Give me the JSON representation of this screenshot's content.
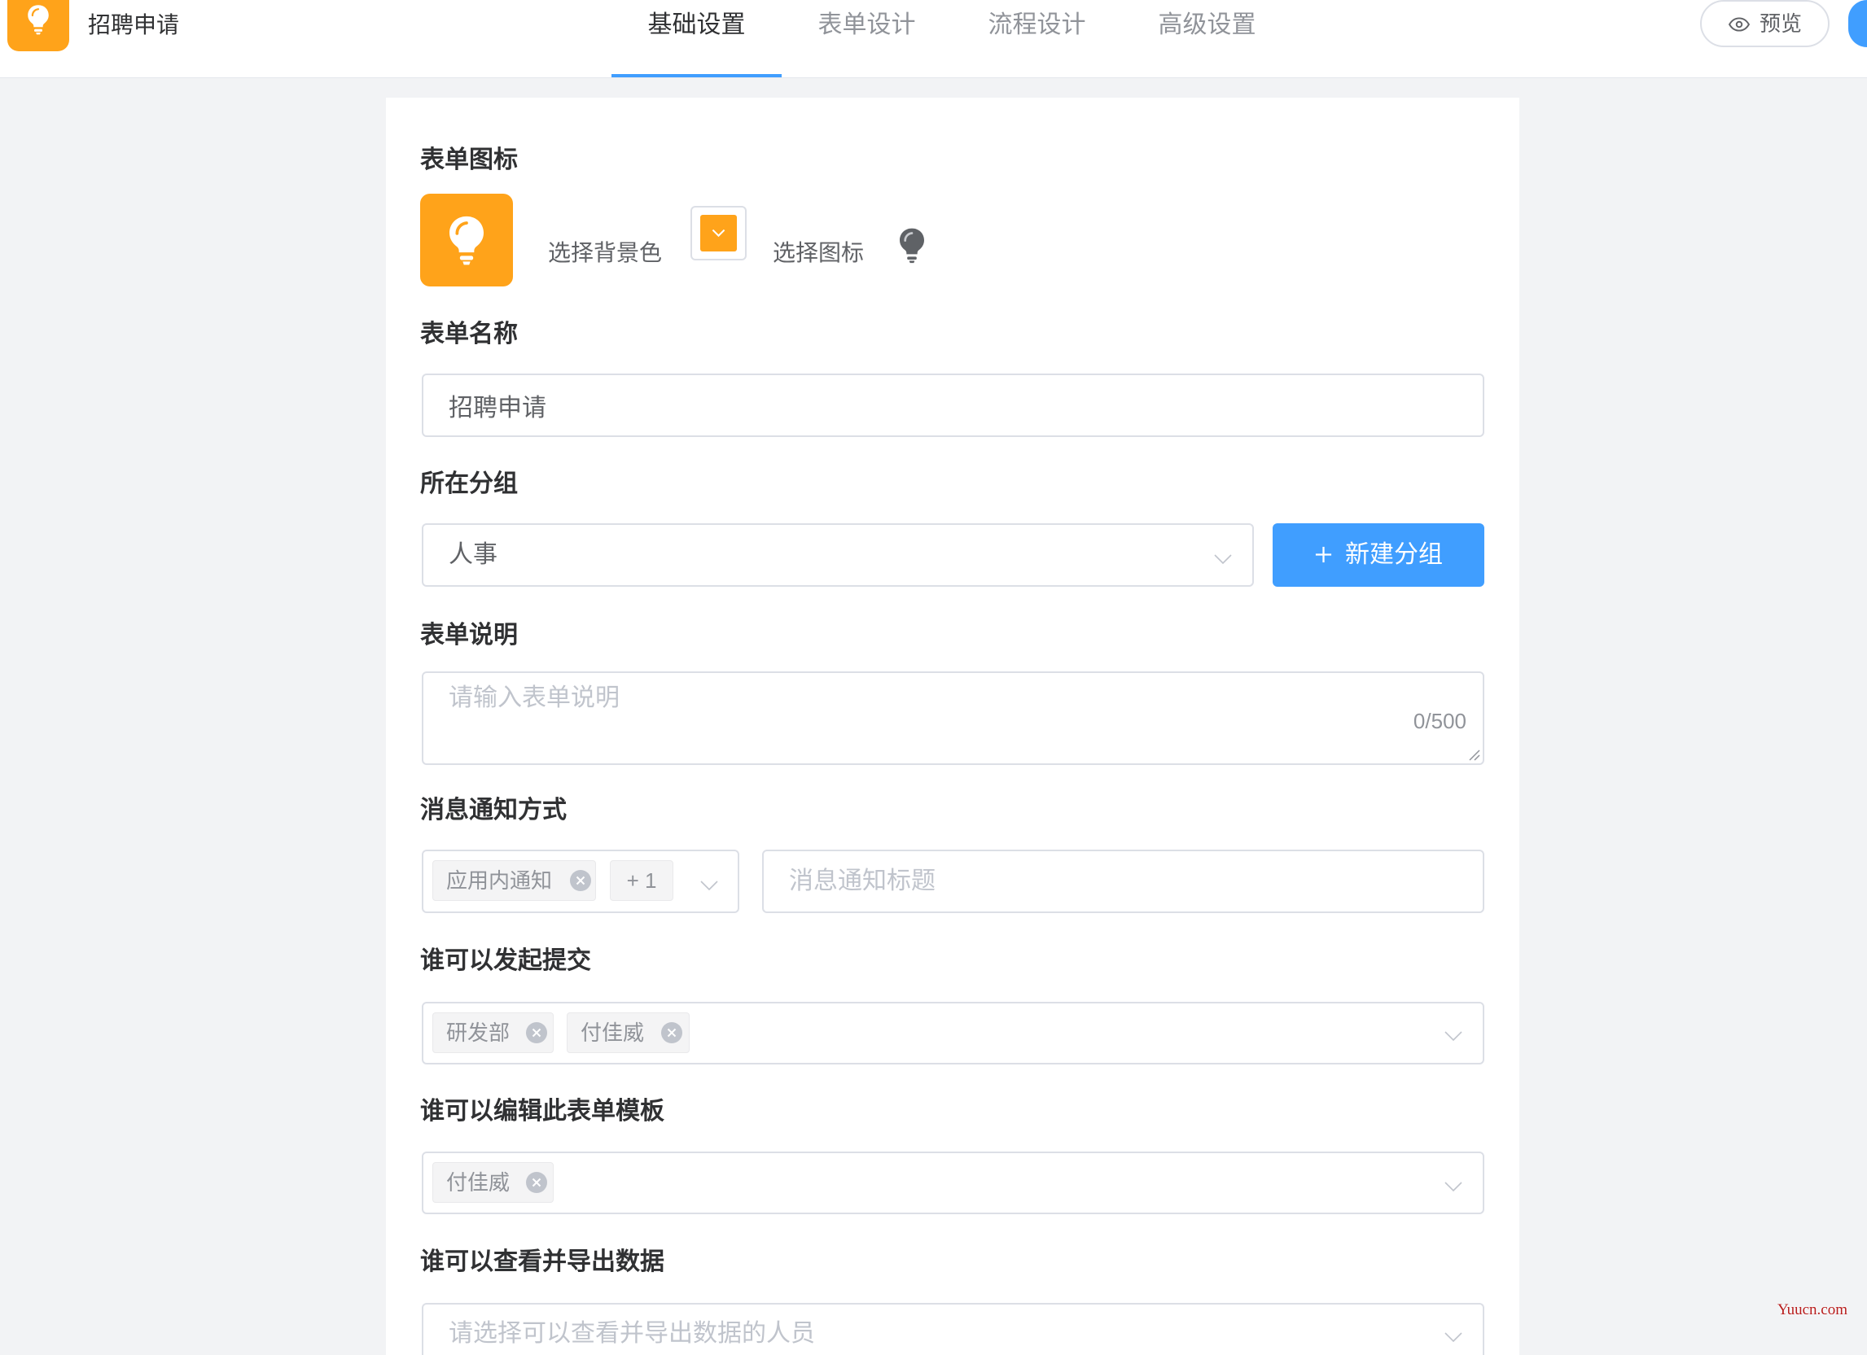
{
  "header": {
    "app_title": "招聘申请",
    "tabs": [
      {
        "label": "基础设置",
        "active": true
      },
      {
        "label": "表单设计",
        "active": false
      },
      {
        "label": "流程设计",
        "active": false
      },
      {
        "label": "高级设置",
        "active": false
      }
    ],
    "preview_label": "预览"
  },
  "form": {
    "icon_section": {
      "label": "表单图标",
      "bg_color_label": "选择背景色",
      "icon_label": "选择图标",
      "selected_icon": "lightbulb-icon"
    },
    "name": {
      "label": "表单名称",
      "value": "招聘申请"
    },
    "group": {
      "label": "所在分组",
      "value": "人事",
      "new_group_button": "新建分组"
    },
    "description": {
      "label": "表单说明",
      "placeholder": "请输入表单说明",
      "counter": "0/500"
    },
    "notification": {
      "label": "消息通知方式",
      "tags": [
        "应用内通知"
      ],
      "more_count": "+ 1",
      "title_placeholder": "消息通知标题"
    },
    "submitters": {
      "label": "谁可以发起提交",
      "tags": [
        "研发部",
        "付佳威"
      ]
    },
    "editors": {
      "label": "谁可以编辑此表单模板",
      "tags": [
        "付佳威"
      ]
    },
    "viewers": {
      "label": "谁可以查看并导出数据",
      "placeholder": "请选择可以查看并导出数据的人员"
    }
  },
  "colors": {
    "brand": "#FFA31A",
    "accent": "#409EFF",
    "watermark": "#B71C1C"
  },
  "watermark": "Yuucn.com"
}
